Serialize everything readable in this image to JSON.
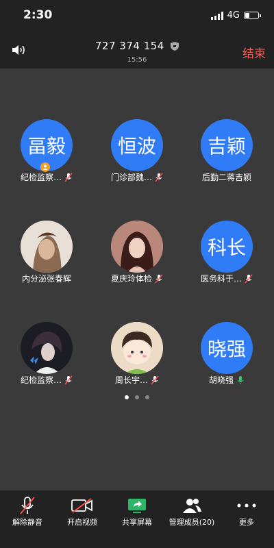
{
  "status_bar": {
    "time": "2:30",
    "network": "4G"
  },
  "header": {
    "meeting_id": "727 374 154",
    "duration": "15:56",
    "end_label": "结束"
  },
  "participants": [
    {
      "avatar_text": "畐毅",
      "name": "纪检监察…",
      "avatar_type": "text",
      "host": true,
      "mic": "muted"
    },
    {
      "avatar_text": "恒波",
      "name": "门诊部魏…",
      "avatar_type": "text",
      "mic": "muted"
    },
    {
      "avatar_text": "吉颖",
      "name": "后勤二蒋吉颖",
      "avatar_type": "text",
      "mic": "none"
    },
    {
      "avatar_text": "",
      "name": "内分泌张春辉",
      "avatar_type": "photo",
      "mic": "none"
    },
    {
      "avatar_text": "",
      "name": "夏庆玲体检",
      "avatar_type": "photo",
      "mic": "muted"
    },
    {
      "avatar_text": "科长",
      "name": "医务科于…",
      "avatar_type": "text",
      "mic": "muted"
    },
    {
      "avatar_text": "",
      "name": "纪检监察…",
      "avatar_type": "photo",
      "mic": "muted"
    },
    {
      "avatar_text": "",
      "name": "周长宇…",
      "avatar_type": "photo",
      "mic": "muted"
    },
    {
      "avatar_text": "晓强",
      "name": "胡晓强",
      "avatar_type": "text",
      "mic": "active"
    }
  ],
  "pagination": {
    "pages": 3,
    "current": 1
  },
  "toolbar": {
    "unmute": "解除静音",
    "video": "开启视频",
    "share": "共享屏幕",
    "members": "管理成员(20)",
    "more": "更多"
  },
  "colors": {
    "avatar_blue": "#2f7cf6",
    "end_red": "#ff5a4e",
    "mic_active": "#3cc46a",
    "share_green": "#2fb56a",
    "host_badge": "#f0a02a"
  }
}
